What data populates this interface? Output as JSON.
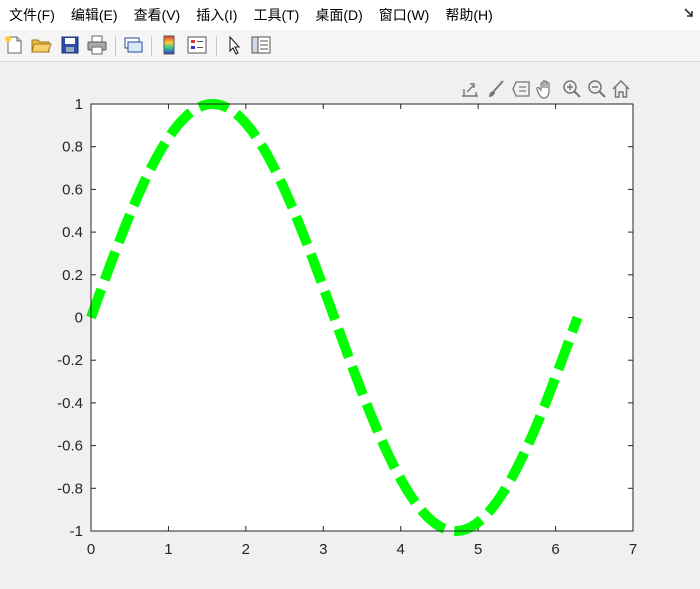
{
  "menu": {
    "items": [
      "文件(F)",
      "编辑(E)",
      "查看(V)",
      "插入(I)",
      "工具(T)",
      "桌面(D)",
      "窗口(W)",
      "帮助(H)"
    ]
  },
  "toolbar": {
    "buttons": [
      "new-figure",
      "open-file",
      "save",
      "print",
      "link",
      "colorbar",
      "legend",
      "edit-plot",
      "property-inspector"
    ]
  },
  "axes_toolbar": {
    "buttons": [
      "export",
      "brush",
      "data-tips",
      "pan",
      "zoom-in",
      "zoom-out",
      "restore-view"
    ]
  },
  "colors": {
    "line": "#00ff00",
    "axes": "#262626",
    "figure_bg": "#f0f0f0",
    "axes_bg": "#ffffff"
  },
  "chart_data": {
    "type": "line",
    "function": "sin(x)",
    "x_start": 0,
    "x_end": 6.2832,
    "line_style": "dashed",
    "xlim": [
      0,
      7
    ],
    "ylim": [
      -1,
      1
    ],
    "xticks": [
      "0",
      "1",
      "2",
      "3",
      "4",
      "5",
      "6",
      "7"
    ],
    "yticks": [
      "1",
      "0.8",
      "0.6",
      "0.4",
      "0.2",
      "0",
      "-0.2",
      "-0.4",
      "-0.6",
      "-0.8",
      "-1"
    ],
    "series": [
      {
        "x": [
          0,
          0.3,
          0.6,
          0.9,
          1.2,
          1.5708,
          1.8,
          2.1,
          2.4,
          2.7,
          3.0,
          3.1416,
          3.3,
          3.6,
          3.9,
          4.2,
          4.5,
          4.7124,
          5.0,
          5.3,
          5.6,
          5.9,
          6.2832
        ],
        "y": [
          0,
          0.296,
          0.565,
          0.783,
          0.932,
          1.0,
          0.974,
          0.863,
          0.675,
          0.427,
          0.141,
          0,
          -0.158,
          -0.443,
          -0.688,
          -0.872,
          -0.978,
          -1.0,
          -0.959,
          -0.832,
          -0.631,
          -0.374,
          0
        ]
      }
    ],
    "grid": false
  }
}
